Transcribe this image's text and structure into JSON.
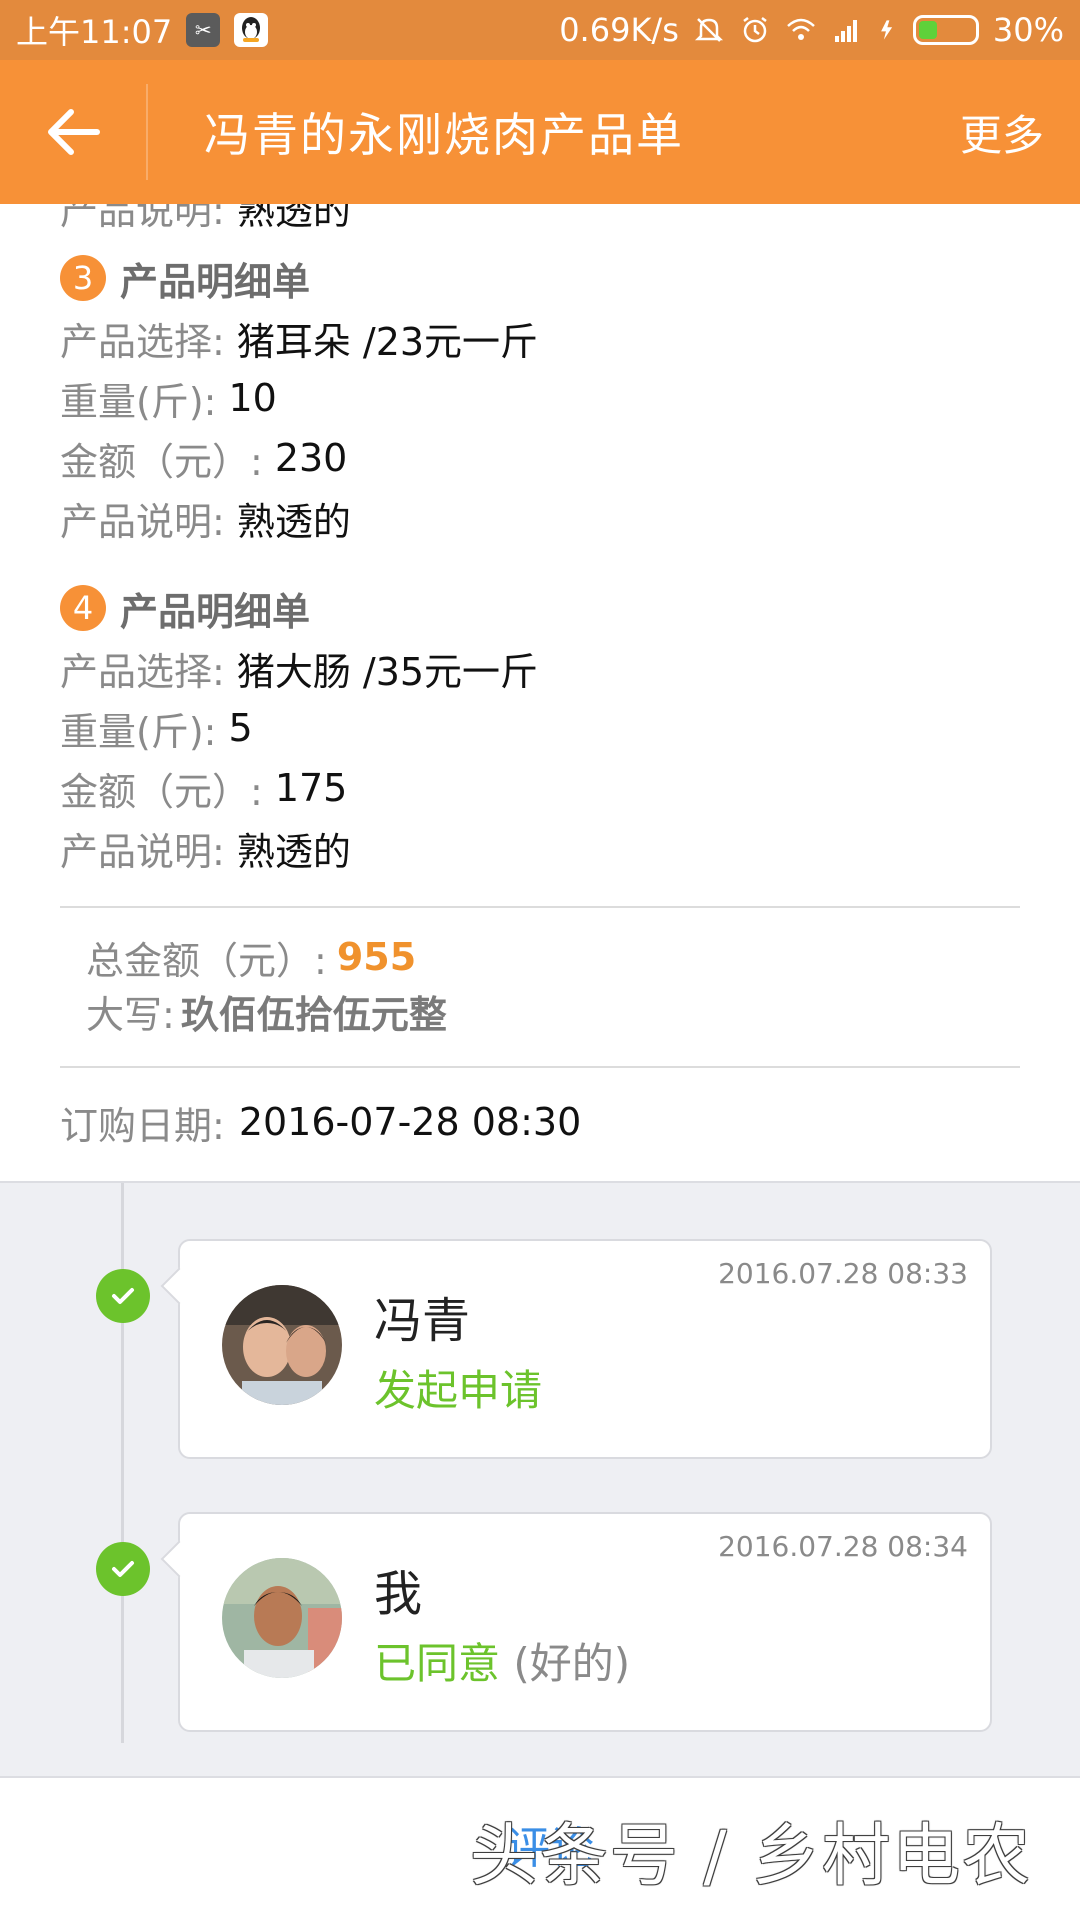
{
  "status_bar": {
    "time": "上午11:07",
    "net_speed": "0.69K/s",
    "battery": "30%"
  },
  "title_bar": {
    "title": "冯青的永刚烧肉产品单",
    "more": "更多"
  },
  "partial_row": {
    "label": "产品说明:",
    "value": "熟透的"
  },
  "sections": [
    {
      "num": "3",
      "title": "产品明细单",
      "rows": [
        {
          "label": "产品选择:",
          "value": "猪耳朵 /23元一斤"
        },
        {
          "label": "重量(斤):",
          "value": "10"
        },
        {
          "label": "金额（元）:",
          "value": "230"
        },
        {
          "label": "产品说明:",
          "value": "熟透的"
        }
      ]
    },
    {
      "num": "4",
      "title": "产品明细单",
      "rows": [
        {
          "label": "产品选择:",
          "value": "猪大肠 /35元一斤"
        },
        {
          "label": "重量(斤):",
          "value": "5"
        },
        {
          "label": "金额（元）:",
          "value": "175"
        },
        {
          "label": "产品说明:",
          "value": "熟透的"
        }
      ]
    }
  ],
  "total": {
    "label": "总金额（元）:",
    "amount": "955",
    "caps_label": "大写:",
    "caps_value": "玖佰伍拾伍元整"
  },
  "order_date": {
    "label": "订购日期:",
    "value": "2016-07-28 08:30"
  },
  "timeline": [
    {
      "time": "2016.07.28 08:33",
      "name": "冯青",
      "status": "发起申请",
      "note": ""
    },
    {
      "time": "2016.07.28 08:34",
      "name": "我",
      "status": "已同意",
      "note": "(好的)"
    }
  ],
  "bottom": {
    "evaluate": "评论",
    "watermark": "头条号 / 乡村电农"
  },
  "colors": {
    "accent": "#f79137",
    "status_bar": "#e38a3d",
    "success": "#6cc32c",
    "amount": "#f0922d"
  }
}
